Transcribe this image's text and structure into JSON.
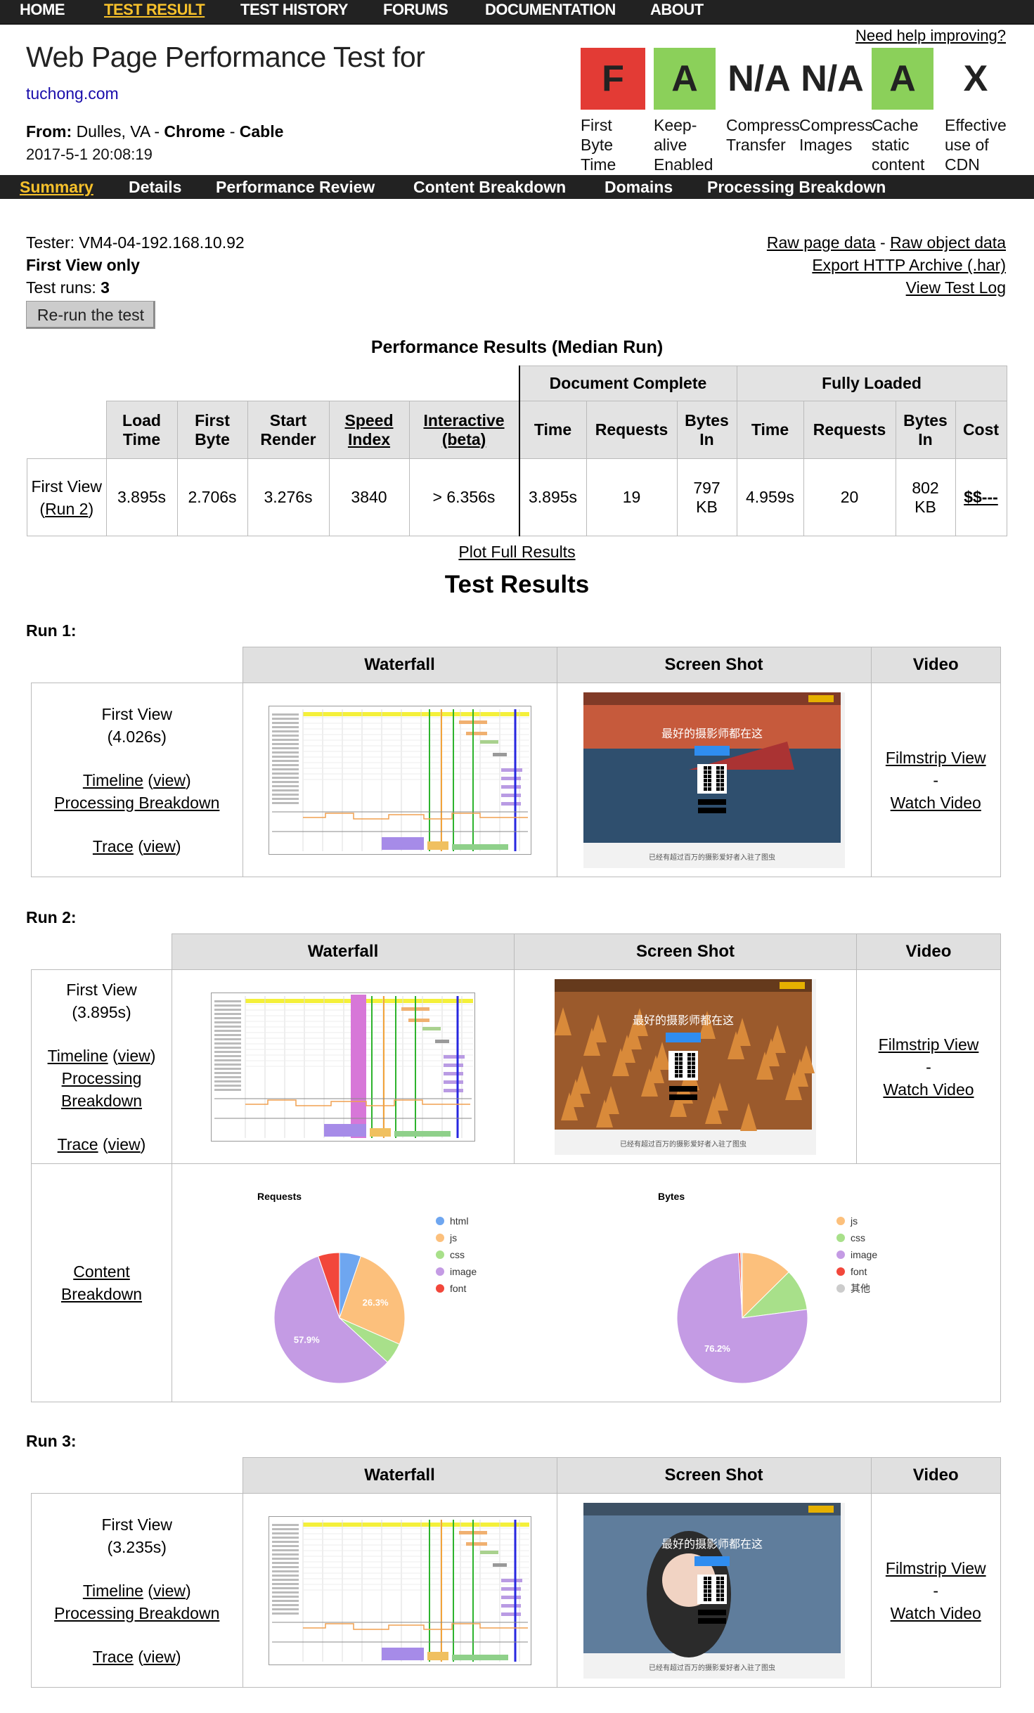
{
  "nav": {
    "items": [
      "HOME",
      "TEST RESULT",
      "TEST HISTORY",
      "FORUMS",
      "DOCUMENTATION",
      "ABOUT"
    ],
    "active": 1
  },
  "header": {
    "title": "Web Page Performance Test for",
    "site": "tuchong.com",
    "from_label": "From:",
    "location": "Dulles, VA",
    "browser": "Chrome",
    "connection": "Cable",
    "date": "2017-5-1 20:08:19",
    "need_help": "Need help improving?"
  },
  "grades": [
    {
      "grade": "F",
      "label": "First Byte Time",
      "color": "#e33b35"
    },
    {
      "grade": "A",
      "label": "Keep-alive Enabled",
      "color": "#8bd05a"
    },
    {
      "grade": "N/A",
      "label": "Compress Transfer",
      "color": "#ffffff"
    },
    {
      "grade": "N/A",
      "label": "Compress Images",
      "color": "#ffffff"
    },
    {
      "grade": "A",
      "label": "Cache static content",
      "color": "#8bd05a"
    },
    {
      "grade": "X",
      "label": "Effective use of CDN",
      "color": "#ffffff"
    }
  ],
  "subnav": {
    "items": [
      "Summary",
      "Details",
      "Performance Review",
      "Content Breakdown",
      "Domains",
      "Processing Breakdown"
    ],
    "active": 0
  },
  "tester": {
    "tester": "Tester: VM4-04-192.168.10.92",
    "view": "First View only",
    "runs_label": "Test runs: ",
    "runs": "3",
    "rerun": "Re-run the test",
    "raw_page": "Raw page data",
    "sep": " - ",
    "raw_object": "Raw object data",
    "export_har": "Export HTTP Archive (.har)",
    "view_log": "View Test Log"
  },
  "median": {
    "title": "Performance Results (Median Run)",
    "group_doc": "Document Complete",
    "group_full": "Fully Loaded",
    "headers": [
      "Load Time",
      "First Byte",
      "Start Render",
      "Speed Index",
      "Interactive (beta)",
      "Time",
      "Requests",
      "Bytes In",
      "Time",
      "Requests",
      "Bytes In",
      "Cost"
    ],
    "row_label": "First View",
    "row_link": "Run 2",
    "values": [
      "3.895s",
      "2.706s",
      "3.276s",
      "3840",
      "> 6.356s",
      "3.895s",
      "19",
      "797 KB",
      "4.959s",
      "20",
      "802 KB",
      "$$---"
    ],
    "plot_full": "Plot Full Results"
  },
  "results": {
    "title": "Test Results",
    "col_waterfall": "Waterfall",
    "col_screenshot": "Screen Shot",
    "col_video": "Video",
    "first_view": "First View",
    "timeline": "Timeline",
    "view": "view",
    "processing": "Processing Breakdown",
    "trace": "Trace",
    "filmstrip": "Filmstrip View",
    "dash": "-",
    "watch": "Watch Video",
    "content_breakdown": "Content Breakdown",
    "screenshot_banner": "最好的摄影师都在这",
    "screenshot_footer": "已经有超过百万的摄影爱好者入驻了图虫",
    "runs": [
      {
        "label": "Run 1:",
        "time": "(4.026s)"
      },
      {
        "label": "Run 2:",
        "time": "(3.895s)"
      },
      {
        "label": "Run 3:",
        "time": "(3.235s)"
      }
    ]
  },
  "chart_data": [
    {
      "type": "pie",
      "title": "Requests",
      "categories": [
        "html",
        "js",
        "css",
        "image",
        "font"
      ],
      "values": [
        5.3,
        26.3,
        5.3,
        57.9,
        5.3
      ],
      "slice_labels": [
        "",
        "26.3%",
        "",
        "57.9%",
        ""
      ],
      "colors": [
        "#6ea6f0",
        "#fcc07c",
        "#a8e08a",
        "#c49be4",
        "#f2473b"
      ],
      "legend": "right"
    },
    {
      "type": "pie",
      "title": "Bytes",
      "categories": [
        "js",
        "css",
        "image",
        "font",
        "其他"
      ],
      "values": [
        12.6,
        10.3,
        76.2,
        0.5,
        0.4
      ],
      "slice_labels": [
        "",
        "",
        "76.2%",
        "",
        ""
      ],
      "colors": [
        "#fcc07c",
        "#a8e08a",
        "#c49be4",
        "#f2473b",
        "#cccccc"
      ],
      "legend": "right"
    }
  ]
}
